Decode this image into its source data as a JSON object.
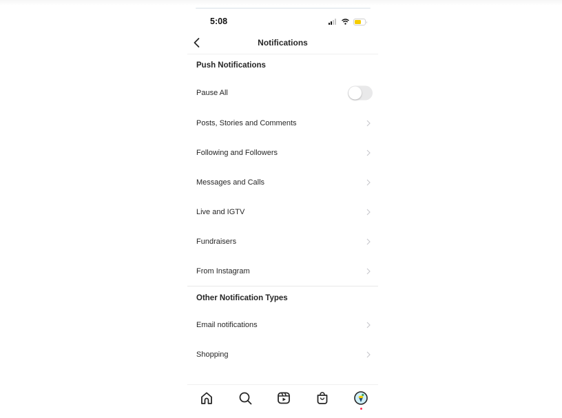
{
  "status_bar": {
    "time": "5:08",
    "signal_icon": "cellular-signal-icon",
    "wifi_icon": "wifi-icon",
    "battery_icon": "battery-icon",
    "battery_color": "#f5cc00"
  },
  "header": {
    "title": "Notifications",
    "back_icon": "chevron-left-icon"
  },
  "sections": [
    {
      "heading": "Push Notifications",
      "items": [
        {
          "label": "Pause All",
          "control": "toggle",
          "value": false
        },
        {
          "label": "Posts, Stories and Comments",
          "control": "chevron"
        },
        {
          "label": "Following and Followers",
          "control": "chevron"
        },
        {
          "label": "Messages and Calls",
          "control": "chevron"
        },
        {
          "label": "Live and IGTV",
          "control": "chevron"
        },
        {
          "label": "Fundraisers",
          "control": "chevron"
        },
        {
          "label": "From Instagram",
          "control": "chevron"
        }
      ]
    },
    {
      "heading": "Other Notification Types",
      "items": [
        {
          "label": "Email notifications",
          "control": "chevron"
        },
        {
          "label": "Shopping",
          "control": "chevron"
        }
      ]
    }
  ],
  "tab_bar": {
    "tabs": [
      {
        "name": "home",
        "icon": "home-icon"
      },
      {
        "name": "search",
        "icon": "search-icon"
      },
      {
        "name": "reels",
        "icon": "reels-icon"
      },
      {
        "name": "shop",
        "icon": "shopping-bag-icon"
      },
      {
        "name": "profile",
        "icon": "avatar-icon",
        "has_notification_dot": true
      }
    ],
    "notification_dot_color": "#ff2d55"
  }
}
